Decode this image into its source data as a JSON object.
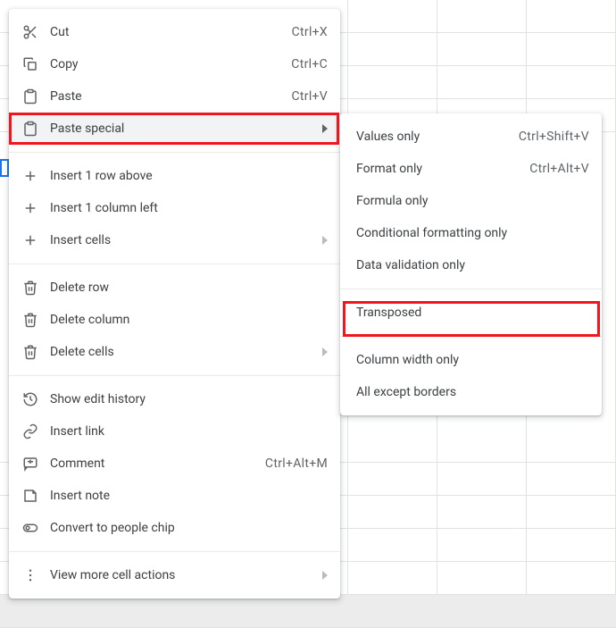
{
  "menu": {
    "cut": {
      "label": "Cut",
      "shortcut": "Ctrl+X"
    },
    "copy": {
      "label": "Copy",
      "shortcut": "Ctrl+C"
    },
    "paste": {
      "label": "Paste",
      "shortcut": "Ctrl+V"
    },
    "paste_special": {
      "label": "Paste special"
    },
    "insert_row_above": {
      "label": "Insert 1 row above"
    },
    "insert_col_left": {
      "label": "Insert 1 column left"
    },
    "insert_cells": {
      "label": "Insert cells"
    },
    "delete_row": {
      "label": "Delete row"
    },
    "delete_column": {
      "label": "Delete column"
    },
    "delete_cells": {
      "label": "Delete cells"
    },
    "show_edit_history": {
      "label": "Show edit history"
    },
    "insert_link": {
      "label": "Insert link"
    },
    "comment": {
      "label": "Comment",
      "shortcut": "Ctrl+Alt+M"
    },
    "insert_note": {
      "label": "Insert note"
    },
    "people_chip": {
      "label": "Convert to people chip"
    },
    "view_more": {
      "label": "View more cell actions"
    }
  },
  "submenu": {
    "values_only": {
      "label": "Values only",
      "shortcut": "Ctrl+Shift+V"
    },
    "format_only": {
      "label": "Format only",
      "shortcut": "Ctrl+Alt+V"
    },
    "formula_only": {
      "label": "Formula only"
    },
    "cond_fmt_only": {
      "label": "Conditional formatting only"
    },
    "data_val_only": {
      "label": "Data validation only"
    },
    "transposed": {
      "label": "Transposed"
    },
    "col_width_only": {
      "label": "Column width only"
    },
    "all_except_borders": {
      "label": "All except borders"
    }
  }
}
